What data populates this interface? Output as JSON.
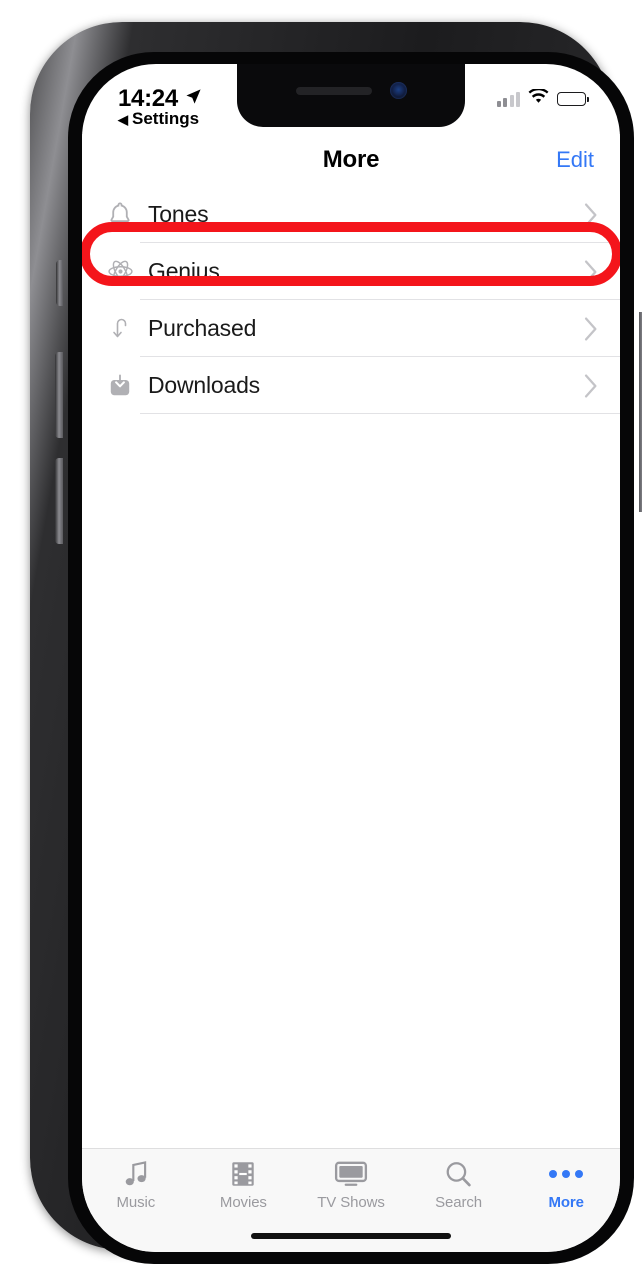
{
  "device": {
    "name": "iphone-x",
    "frame_color": "#1c1c1e"
  },
  "status_bar": {
    "time": "14:24",
    "location_icon": "location-arrow-icon",
    "signal_icon": "cellular-signal-icon",
    "wifi_icon": "wifi-icon",
    "battery_icon": "battery-full-icon"
  },
  "back_to_app": {
    "arrow": "◀",
    "label": "Settings"
  },
  "nav_bar": {
    "title": "More",
    "edit_label": "Edit",
    "accent_color": "#3478f6"
  },
  "annotation": {
    "type": "red-oval-highlight",
    "color": "#f4151b",
    "target": "Tones"
  },
  "list": {
    "rows": [
      {
        "label": "Tones",
        "icon": "bell-icon",
        "chevron": "chevron-right-icon",
        "highlighted": true
      },
      {
        "label": "Genius",
        "icon": "atom-icon",
        "chevron": "chevron-right-icon",
        "highlighted": false
      },
      {
        "label": "Purchased",
        "icon": "purchased-icon",
        "chevron": "chevron-right-icon",
        "highlighted": false
      },
      {
        "label": "Downloads",
        "icon": "download-icon",
        "chevron": "chevron-right-icon",
        "highlighted": false
      }
    ]
  },
  "tab_bar": {
    "items": [
      {
        "label": "Music",
        "icon": "music-note-icon",
        "active": false
      },
      {
        "label": "Movies",
        "icon": "film-strip-icon",
        "active": false
      },
      {
        "label": "TV Shows",
        "icon": "tv-monitor-icon",
        "active": false
      },
      {
        "label": "Search",
        "icon": "magnifier-icon",
        "active": false
      },
      {
        "label": "More",
        "icon": "ellipsis-icon",
        "active": true
      }
    ],
    "active_color": "#3478f6",
    "inactive_color": "#9a9a9f"
  }
}
